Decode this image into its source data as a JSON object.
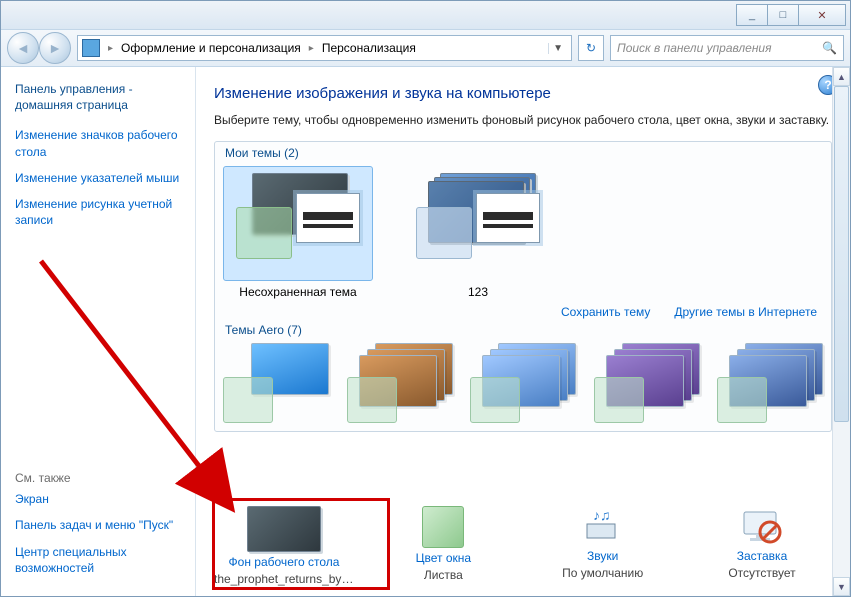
{
  "titlebar": {
    "min": "_",
    "max": "□",
    "close": "✕"
  },
  "nav": {
    "back": "◄",
    "fwd": "►",
    "crumbs": [
      "Оформление и персонализация",
      "Персонализация"
    ],
    "refresh": "↻",
    "search_placeholder": "Поиск в панели управления"
  },
  "sidebar": {
    "home": "Панель управления - домашняя страница",
    "links": [
      "Изменение значков рабочего стола",
      "Изменение указателей мыши",
      "Изменение рисунка учетной записи"
    ],
    "see_also": "См. также",
    "see_links": [
      "Экран",
      "Панель задач и меню \"Пуск\"",
      "Центр специальных возможностей"
    ]
  },
  "content": {
    "title": "Изменение изображения и звука на компьютере",
    "desc": "Выберите тему, чтобы одновременно изменить фоновый рисунок рабочего стола, цвет окна, звуки и заставку.",
    "group_my": "Мои темы (2)",
    "themes": [
      {
        "label": "Несохраненная тема"
      },
      {
        "label": "123"
      }
    ],
    "action_save": "Сохранить тему",
    "action_online": "Другие темы в Интернете",
    "group_aero": "Темы Aero (7)"
  },
  "bottom": [
    {
      "label": "Фон рабочего стола",
      "value": "the_prophet_returns_by_m..."
    },
    {
      "label": "Цвет окна",
      "value": "Листва"
    },
    {
      "label": "Звуки",
      "value": "По умолчанию"
    },
    {
      "label": "Заставка",
      "value": "Отсутствует"
    }
  ],
  "help": "?"
}
